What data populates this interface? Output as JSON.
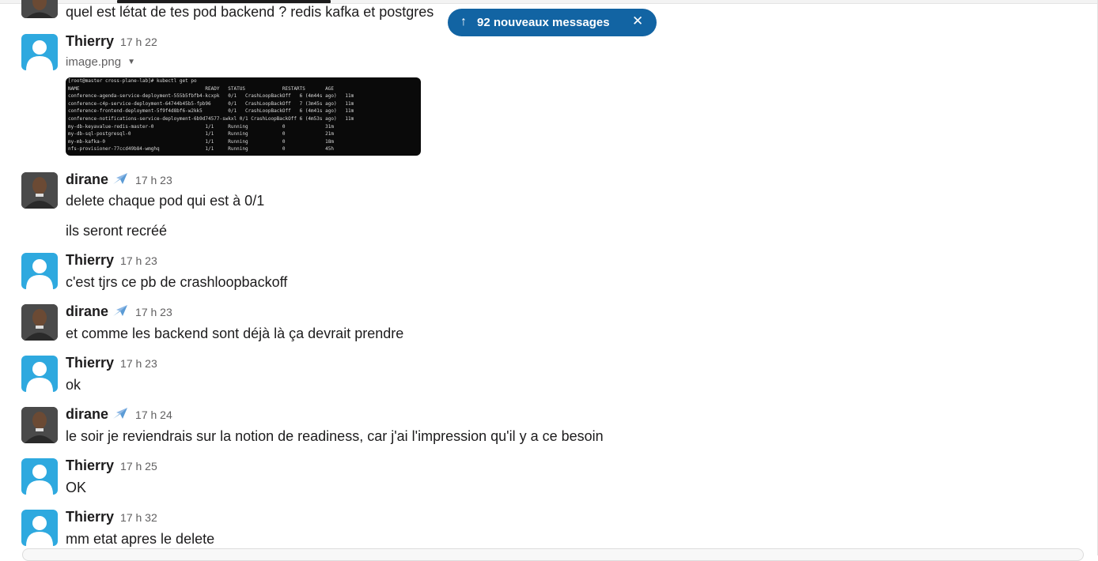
{
  "jump_pill": {
    "label": "92 nouveaux messages",
    "arrow": "↑",
    "close": "✕"
  },
  "prev_message": {
    "text": "quel est létat de tes pod backend ? redis kafka et postgres"
  },
  "messages": [
    {
      "author": "Thierry",
      "time": "17 h 22",
      "file": "image.png",
      "caret": "▼",
      "terminal": [
        "[root@master cross-plane-lab]# kubectl get po",
        "NAME                                            READY   STATUS             RESTARTS       AGE",
        "conference-agenda-service-deployment-555b5fbfb4-kcxpk   0/1   CrashLoopBackOff   6 (4m44s ago)   11m",
        "conference-c4p-service-deployment-64744b45b5-fpb96      0/1   CrashLoopBackOff   7 (3m45s ago)   11m",
        "conference-frontend-deployment-5f9f4d8bf6-w2kk5         0/1   CrashLoopBackOff   6 (4m41s ago)   11m",
        "conference-notifications-service-deployment-6b9d74577-swkxl 0/1 CrashLoopBackOff 6 (4m53s ago)   11m",
        "my-db-keyavalue-redis-master-0                  1/1     Running            0              31m",
        "my-db-sql-postgresql-0                          1/1     Running            0              21m",
        "my-mb-kafka-0                                   1/1     Running            0              18m",
        "nfs-provisioner-77ccd49b84-wmghq                1/1     Running            0              45h"
      ]
    },
    {
      "author": "dirane",
      "time": "17 h 23",
      "lines": [
        "delete chaque pod qui est à 0/1",
        "ils seront recréé"
      ]
    },
    {
      "author": "Thierry",
      "time": "17 h 23",
      "lines": [
        "c'est tjrs ce pb de crashloopbackoff"
      ]
    },
    {
      "author": "dirane",
      "time": "17 h 23",
      "lines": [
        "et comme les backend sont déjà là ça devrait prendre"
      ]
    },
    {
      "author": "Thierry",
      "time": "17 h 23",
      "lines": [
        "ok"
      ]
    },
    {
      "author": "dirane",
      "time": "17 h 24",
      "lines": [
        "le soir je reviendrais sur la notion de readiness, car j'ai l'impression qu'il y a ce besoin"
      ]
    },
    {
      "author": "Thierry",
      "time": "17 h 25",
      "lines": [
        "OK"
      ]
    },
    {
      "author": "Thierry",
      "time": "17 h 32",
      "lines": [
        "mm etat apres le delete"
      ]
    }
  ],
  "icons": {
    "status_emoji": "airplane-icon",
    "avatar_default": "user-silhouette-icon"
  },
  "colors": {
    "accent": "#1264a3",
    "avatar_default": "#2ea9df"
  }
}
